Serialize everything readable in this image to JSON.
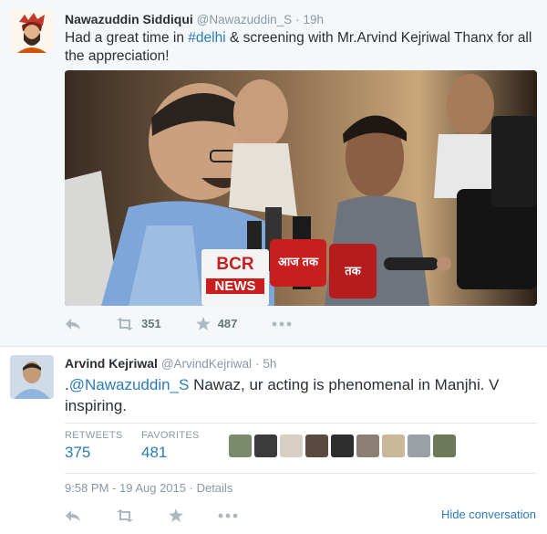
{
  "tweet1": {
    "name": "Nawazuddin Siddiqui",
    "handle": "@Nawazuddin_S",
    "separator": "·",
    "time": "19h",
    "text_before": "Had a great time in ",
    "hashtag": "#delhi",
    "text_after": " & screening with Mr.Arvind Kejriwal Thanx for all the appreciation!",
    "actions": {
      "reply_icon": "reply-icon",
      "retweet_icon": "retweet-icon",
      "retweet_count": "351",
      "favorite_icon": "star-icon",
      "favorite_count": "487",
      "more_icon": "more-icon"
    },
    "photo": {
      "mic_labels": [
        "BCR",
        "NEWS",
        "आज तक",
        "तक"
      ]
    }
  },
  "tweet2": {
    "name": "Arvind Kejriwal",
    "handle": "@ArvindKejriwal",
    "separator": "·",
    "time": "5h",
    "text_prefix": ".",
    "mention": "@Nawazuddin_S",
    "text_after": " Nawaz, ur acting is phenomenal in Manjhi. V inspiring.",
    "stats": {
      "retweets_label": "RETWEETS",
      "retweets_value": "375",
      "favorites_label": "FAVORITES",
      "favorites_value": "481"
    },
    "timestamp": "9:58 PM - 19 Aug 2015",
    "details_sep": "·",
    "details": "Details",
    "hide_conversation": "Hide conversation"
  },
  "colors": {
    "link": "#2b7bb9",
    "muted": "#8899a6",
    "text": "#292f33",
    "tweet1_bg": "#f5f8fa"
  }
}
